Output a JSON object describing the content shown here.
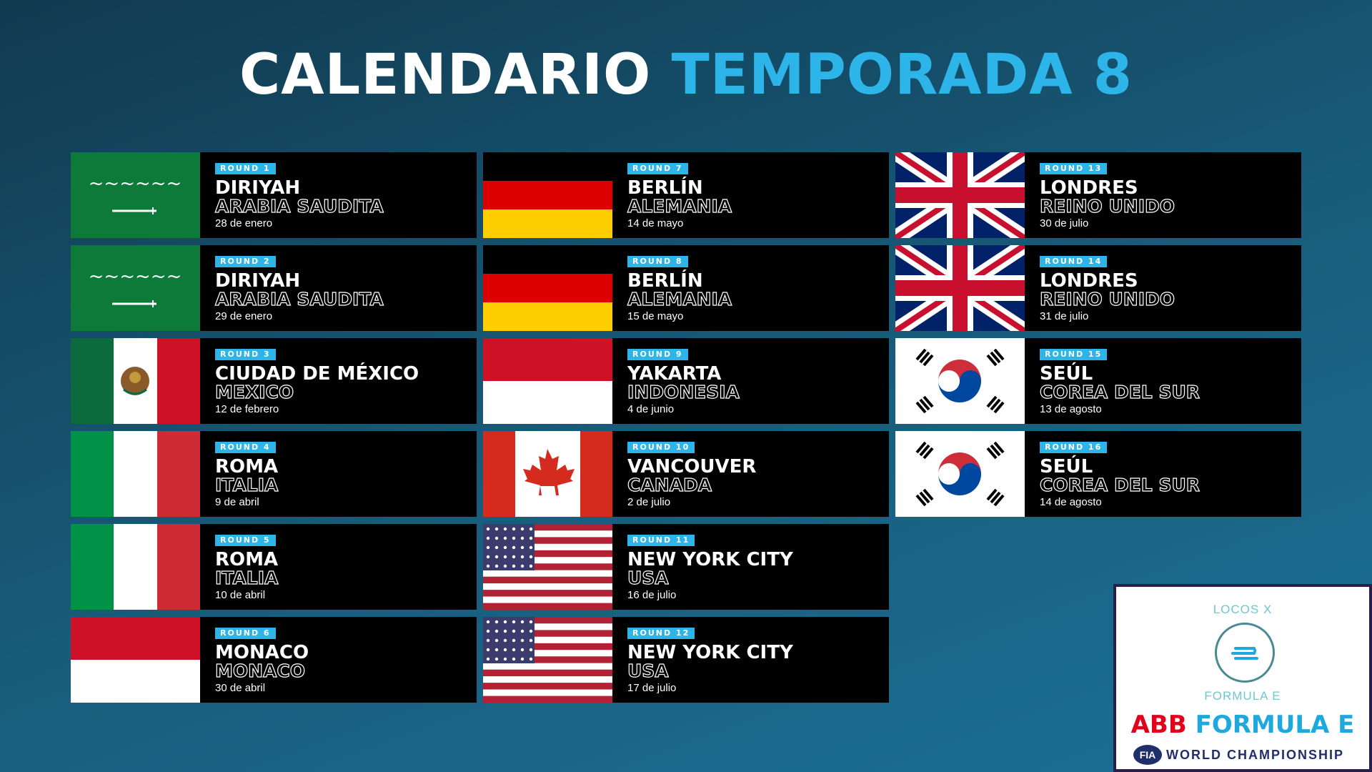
{
  "title": {
    "part1": "CALENDARIO",
    "part2": "TEMPORADA 8"
  },
  "races": [
    {
      "round": "ROUND 1",
      "city": "DIRIYAH",
      "country": "ARABIA SAUDITA",
      "date": "28 de enero",
      "flag": "saudi-arabia-flag"
    },
    {
      "round": "ROUND 2",
      "city": "DIRIYAH",
      "country": "ARABIA SAUDITA",
      "date": "29 de enero",
      "flag": "saudi-arabia-flag"
    },
    {
      "round": "ROUND 3",
      "city": "CIUDAD DE MÉXICO",
      "country": "MEXICO",
      "date": "12 de febrero",
      "flag": "mexico-flag"
    },
    {
      "round": "ROUND 4",
      "city": "ROMA",
      "country": "ITALIA",
      "date": "9 de abril",
      "flag": "italy-flag"
    },
    {
      "round": "ROUND 5",
      "city": "ROMA",
      "country": "ITALIA",
      "date": "10 de abril",
      "flag": "italy-flag"
    },
    {
      "round": "ROUND 6",
      "city": "MONACO",
      "country": "MONACO",
      "date": "30 de abril",
      "flag": "monaco-flag"
    },
    {
      "round": "ROUND 7",
      "city": "BERLÍN",
      "country": "ALEMANIA",
      "date": "14 de mayo",
      "flag": "germany-flag"
    },
    {
      "round": "ROUND 8",
      "city": "BERLÍN",
      "country": "ALEMANIA",
      "date": "15 de mayo",
      "flag": "germany-flag"
    },
    {
      "round": "ROUND 9",
      "city": "YAKARTA",
      "country": "INDONESIA",
      "date": "4 de junio",
      "flag": "indonesia-flag"
    },
    {
      "round": "ROUND 10",
      "city": "VANCOUVER",
      "country": "CANADA",
      "date": "2 de julio",
      "flag": "canada-flag"
    },
    {
      "round": "ROUND 11",
      "city": "NEW YORK CITY",
      "country": "USA",
      "date": "16 de julio",
      "flag": "usa-flag"
    },
    {
      "round": "ROUND 12",
      "city": "NEW YORK CITY",
      "country": "USA",
      "date": "17 de julio",
      "flag": "usa-flag"
    },
    {
      "round": "ROUND 13",
      "city": "LONDRES",
      "country": "REINO UNIDO",
      "date": "30 de julio",
      "flag": "uk-flag"
    },
    {
      "round": "ROUND 14",
      "city": "LONDRES",
      "country": "REINO UNIDO",
      "date": "31 de julio",
      "flag": "uk-flag"
    },
    {
      "round": "ROUND 15",
      "city": "SEÚL",
      "country": "COREA DEL SUR",
      "date": "13 de agosto",
      "flag": "south-korea-flag"
    },
    {
      "round": "ROUND 16",
      "city": "SEÚL",
      "country": "COREA DEL SUR",
      "date": "14 de agosto",
      "flag": "south-korea-flag"
    }
  ],
  "logo": {
    "top_text": "LOCOS X",
    "bottom_text": "FORMULA E",
    "brand_abb": "ABB",
    "brand_fe": "FORMULA E",
    "fia": "FIA",
    "championship": "WORLD CHAMPIONSHIP"
  },
  "colors": {
    "accent": "#2db5ea",
    "card": "#000000",
    "abb_red": "#e2001a"
  }
}
